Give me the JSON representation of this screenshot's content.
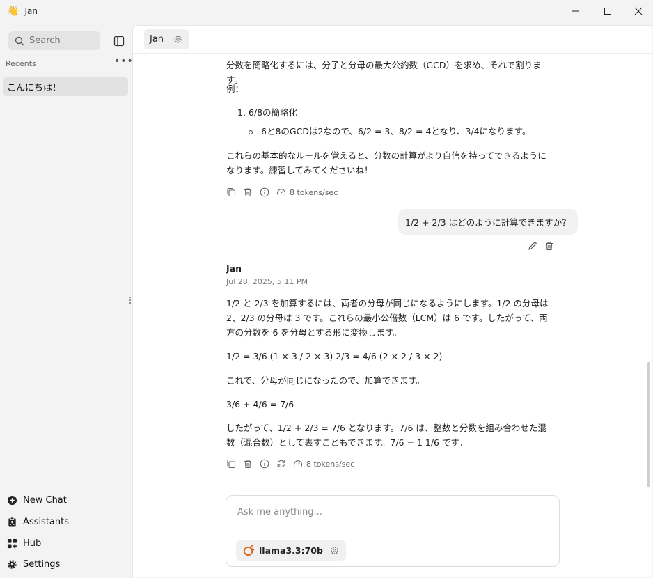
{
  "window": {
    "title": "Jan",
    "icon": "waving-hand-icon"
  },
  "sidebar": {
    "search_placeholder": "Search",
    "recents_label": "Recents",
    "recent_threads": [
      "こんにちは！"
    ],
    "nav": [
      {
        "label": "New Chat",
        "icon": "plus-circle-icon"
      },
      {
        "label": "Assistants",
        "icon": "clipboard-icon"
      },
      {
        "label": "Hub",
        "icon": "grid-icon"
      },
      {
        "label": "Settings",
        "icon": "gear-icon"
      }
    ]
  },
  "header": {
    "tab_label": "Jan"
  },
  "conversation": {
    "prev_reply": {
      "intro": "分数を簡略化するには、分子と分母の最大公約数（GCD）を求め、それで割ります。",
      "example_label": "例：",
      "list_item": "6/8の簡略化",
      "sub_item": "6と8のGCDは2なので、6/2 = 3、8/2 = 4となり、3/4になります。",
      "closing": "これらの基本的なルールを覚えると、分数の計算がより自信を持ってできるようになります。練習してみてくださいね！",
      "speed": "8 tokens/sec"
    },
    "user_message": "1/2 + 2/3 はどのように計算できますか？",
    "assistant": {
      "name": "Jan",
      "timestamp": "Jul 28, 2025, 5:11 PM",
      "paragraphs": [
        "1/2 と 2/3 を加算するには、両者の分母が同じになるようにします。1/2 の分母は 2、2/3 の分母は 3 です。これらの最小公倍数（LCM）は 6 です。したがって、両方の分数を 6 を分母とする形に変換します。",
        "1/2 = 3/6 (1 × 3 / 2 × 3) 2/3 = 4/6 (2 × 2 / 3 × 2)",
        "これで、分母が同じになったので、加算できます。",
        "3/6 + 4/6 = 7/6",
        "したがって、1/2 + 2/3 = 7/6 となります。7/6 は、整数と分数を組み合わせた混数（混合数）として表すこともできます。7/6 = 1 1/6 です。"
      ],
      "speed": "8 tokens/sec"
    }
  },
  "composer": {
    "placeholder": "Ask me anything...",
    "model": "llama3.3:70b"
  }
}
